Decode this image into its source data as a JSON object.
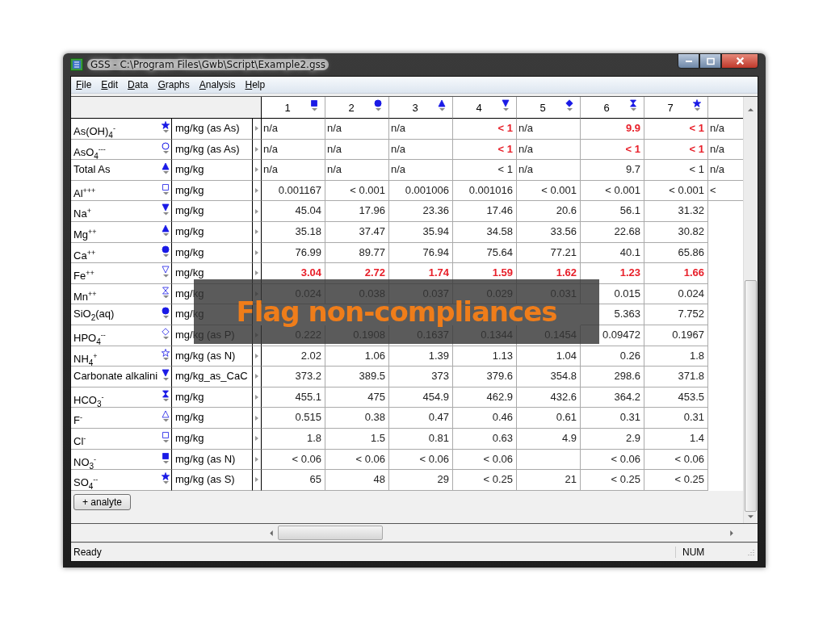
{
  "window": {
    "title": "GSS - C:\\Program Files\\Gwb\\Script\\Example2.gss"
  },
  "menu": [
    "File",
    "Edit",
    "Data",
    "Graphs",
    "Analysis",
    "Help"
  ],
  "columns": [
    {
      "label": "1"
    },
    {
      "label": "2"
    },
    {
      "label": "3"
    },
    {
      "label": "4"
    },
    {
      "label": "5"
    },
    {
      "label": "6"
    },
    {
      "label": "7"
    }
  ],
  "rows": [
    {
      "name": "As(OH)$_{4}$$^{-}$",
      "unit": "mg/kg (as As)",
      "cells": [
        {
          "text": "n/a",
          "kind": "text",
          "flagged": false
        },
        {
          "text": "n/a",
          "kind": "text",
          "flagged": false
        },
        {
          "text": "n/a",
          "kind": "text",
          "flagged": false
        },
        {
          "text": "< 1",
          "kind": "number",
          "flagged": true
        },
        {
          "text": "n/a",
          "kind": "text",
          "flagged": false
        },
        {
          "text": "9.9",
          "kind": "number",
          "flagged": true
        },
        {
          "text": "< 1",
          "kind": "number",
          "flagged": true
        },
        {
          "text": "n/a",
          "kind": "text",
          "flagged": false
        }
      ]
    },
    {
      "name": "AsO$_{4}$$^{---}$",
      "unit": "mg/kg (as As)",
      "cells": [
        {
          "text": "n/a",
          "kind": "text",
          "flagged": false
        },
        {
          "text": "n/a",
          "kind": "text",
          "flagged": false
        },
        {
          "text": "n/a",
          "kind": "text",
          "flagged": false
        },
        {
          "text": "< 1",
          "kind": "number",
          "flagged": true
        },
        {
          "text": "n/a",
          "kind": "text",
          "flagged": false
        },
        {
          "text": "< 1",
          "kind": "number",
          "flagged": true
        },
        {
          "text": "< 1",
          "kind": "number",
          "flagged": true
        },
        {
          "text": "n/a",
          "kind": "text",
          "flagged": false
        }
      ]
    },
    {
      "name": "Total As",
      "unit": "mg/kg",
      "cells": [
        {
          "text": "n/a",
          "kind": "text",
          "flagged": false
        },
        {
          "text": "n/a",
          "kind": "text",
          "flagged": false
        },
        {
          "text": "n/a",
          "kind": "text",
          "flagged": false
        },
        {
          "text": "< 1",
          "kind": "number",
          "flagged": false
        },
        {
          "text": "n/a",
          "kind": "text",
          "flagged": false
        },
        {
          "text": "9.7",
          "kind": "number",
          "flagged": false
        },
        {
          "text": "< 1",
          "kind": "number",
          "flagged": false
        },
        {
          "text": "n/a",
          "kind": "text",
          "flagged": false
        }
      ]
    },
    {
      "name": "Al$^{+++}$",
      "unit": "mg/kg",
      "cells": [
        {
          "text": "0.001167",
          "kind": "number",
          "flagged": false
        },
        {
          "text": "< 0.001",
          "kind": "number",
          "flagged": false
        },
        {
          "text": "0.001006",
          "kind": "number",
          "flagged": false
        },
        {
          "text": "0.001016",
          "kind": "number",
          "flagged": false
        },
        {
          "text": "< 0.001",
          "kind": "number",
          "flagged": false
        },
        {
          "text": "< 0.001",
          "kind": "number",
          "flagged": false
        },
        {
          "text": "< 0.001",
          "kind": "number",
          "flagged": false
        },
        {
          "text": "<",
          "kind": "text",
          "flagged": false
        }
      ]
    },
    {
      "name": "Na$^{+}$",
      "unit": "mg/kg",
      "cells": [
        {
          "text": "45.04",
          "kind": "number",
          "flagged": false
        },
        {
          "text": "17.96",
          "kind": "number",
          "flagged": false
        },
        {
          "text": "23.36",
          "kind": "number",
          "flagged": false
        },
        {
          "text": "17.46",
          "kind": "number",
          "flagged": false
        },
        {
          "text": "20.6",
          "kind": "number",
          "flagged": false
        },
        {
          "text": "56.1",
          "kind": "number",
          "flagged": false
        },
        {
          "text": "31.32",
          "kind": "number",
          "flagged": false
        }
      ]
    },
    {
      "name": "Mg$^{++}$",
      "unit": "mg/kg",
      "cells": [
        {
          "text": "35.18",
          "kind": "number",
          "flagged": false
        },
        {
          "text": "37.47",
          "kind": "number",
          "flagged": false
        },
        {
          "text": "35.94",
          "kind": "number",
          "flagged": false
        },
        {
          "text": "34.58",
          "kind": "number",
          "flagged": false
        },
        {
          "text": "33.56",
          "kind": "number",
          "flagged": false
        },
        {
          "text": "22.68",
          "kind": "number",
          "flagged": false
        },
        {
          "text": "30.82",
          "kind": "number",
          "flagged": false
        }
      ]
    },
    {
      "name": "Ca$^{++}$",
      "unit": "mg/kg",
      "cells": [
        {
          "text": "76.99",
          "kind": "number",
          "flagged": false
        },
        {
          "text": "89.77",
          "kind": "number",
          "flagged": false
        },
        {
          "text": "76.94",
          "kind": "number",
          "flagged": false
        },
        {
          "text": "75.64",
          "kind": "number",
          "flagged": false
        },
        {
          "text": "77.21",
          "kind": "number",
          "flagged": false
        },
        {
          "text": "40.1",
          "kind": "number",
          "flagged": false
        },
        {
          "text": "65.86",
          "kind": "number",
          "flagged": false
        }
      ]
    },
    {
      "name": "Fe$^{++}$",
      "unit": "mg/kg",
      "cells": [
        {
          "text": "3.04",
          "kind": "number",
          "flagged": true
        },
        {
          "text": "2.72",
          "kind": "number",
          "flagged": true
        },
        {
          "text": "1.74",
          "kind": "number",
          "flagged": true
        },
        {
          "text": "1.59",
          "kind": "number",
          "flagged": true
        },
        {
          "text": "1.62",
          "kind": "number",
          "flagged": true
        },
        {
          "text": "1.23",
          "kind": "number",
          "flagged": true
        },
        {
          "text": "1.66",
          "kind": "number",
          "flagged": true
        }
      ]
    },
    {
      "name": "Mn$^{++}$",
      "unit": "mg/kg",
      "cells": [
        {
          "text": "0.024",
          "kind": "number",
          "flagged": false
        },
        {
          "text": "0.038",
          "kind": "number",
          "flagged": false
        },
        {
          "text": "0.037",
          "kind": "number",
          "flagged": false
        },
        {
          "text": "0.029",
          "kind": "number",
          "flagged": false
        },
        {
          "text": "0.031",
          "kind": "number",
          "flagged": false
        },
        {
          "text": "0.015",
          "kind": "number",
          "flagged": false
        },
        {
          "text": "0.024",
          "kind": "number",
          "flagged": false
        }
      ]
    },
    {
      "name": "SiO$_{2}$(aq)",
      "unit": "mg/kg",
      "cells": [
        null,
        null,
        null,
        null,
        null,
        {
          "text": "5.363",
          "kind": "number",
          "flagged": false
        },
        {
          "text": "7.752",
          "kind": "number",
          "flagged": false
        }
      ]
    },
    {
      "name": "HPO$_{4}$$^{--}$",
      "unit": "mg/kg (as P)",
      "cells": [
        {
          "text": "0.222",
          "kind": "number",
          "flagged": false
        },
        {
          "text": "0.1908",
          "kind": "number",
          "flagged": false
        },
        {
          "text": "0.1637",
          "kind": "number",
          "flagged": false
        },
        {
          "text": "0.1344",
          "kind": "number",
          "flagged": false
        },
        {
          "text": "0.1454",
          "kind": "number",
          "flagged": false
        },
        {
          "text": "0.09472",
          "kind": "number",
          "flagged": false
        },
        {
          "text": "0.1967",
          "kind": "number",
          "flagged": false
        }
      ]
    },
    {
      "name": "NH$_{4}$$^{+}$",
      "unit": "mg/kg (as N)",
      "cells": [
        {
          "text": "2.02",
          "kind": "number",
          "flagged": false
        },
        {
          "text": "1.06",
          "kind": "number",
          "flagged": false
        },
        {
          "text": "1.39",
          "kind": "number",
          "flagged": false
        },
        {
          "text": "1.13",
          "kind": "number",
          "flagged": false
        },
        {
          "text": "1.04",
          "kind": "number",
          "flagged": false
        },
        {
          "text": "0.26",
          "kind": "number",
          "flagged": false
        },
        {
          "text": "1.8",
          "kind": "number",
          "flagged": false
        }
      ]
    },
    {
      "name": "Carbonate alkalini",
      "unit": "mg/kg_as_CaC",
      "cells": [
        {
          "text": "373.2",
          "kind": "number",
          "flagged": false
        },
        {
          "text": "389.5",
          "kind": "number",
          "flagged": false
        },
        {
          "text": "373",
          "kind": "number",
          "flagged": false
        },
        {
          "text": "379.6",
          "kind": "number",
          "flagged": false
        },
        {
          "text": "354.8",
          "kind": "number",
          "flagged": false
        },
        {
          "text": "298.6",
          "kind": "number",
          "flagged": false
        },
        {
          "text": "371.8",
          "kind": "number",
          "flagged": false
        }
      ]
    },
    {
      "name": "HCO$_{3}$$^{-}$",
      "unit": "mg/kg",
      "cells": [
        {
          "text": "455.1",
          "kind": "number",
          "flagged": false
        },
        {
          "text": "475",
          "kind": "number",
          "flagged": false
        },
        {
          "text": "454.9",
          "kind": "number",
          "flagged": false
        },
        {
          "text": "462.9",
          "kind": "number",
          "flagged": false
        },
        {
          "text": "432.6",
          "kind": "number",
          "flagged": false
        },
        {
          "text": "364.2",
          "kind": "number",
          "flagged": false
        },
        {
          "text": "453.5",
          "kind": "number",
          "flagged": false
        }
      ]
    },
    {
      "name": "F$^{-}$",
      "unit": "mg/kg",
      "cells": [
        {
          "text": "0.515",
          "kind": "number",
          "flagged": false
        },
        {
          "text": "0.38",
          "kind": "number",
          "flagged": false
        },
        {
          "text": "0.47",
          "kind": "number",
          "flagged": false
        },
        {
          "text": "0.46",
          "kind": "number",
          "flagged": false
        },
        {
          "text": "0.61",
          "kind": "number",
          "flagged": false
        },
        {
          "text": "0.31",
          "kind": "number",
          "flagged": false
        },
        {
          "text": "0.31",
          "kind": "number",
          "flagged": false
        }
      ]
    },
    {
      "name": "Cl$^{-}$",
      "unit": "mg/kg",
      "cells": [
        {
          "text": "1.8",
          "kind": "number",
          "flagged": false
        },
        {
          "text": "1.5",
          "kind": "number",
          "flagged": false
        },
        {
          "text": "0.81",
          "kind": "number",
          "flagged": false
        },
        {
          "text": "0.63",
          "kind": "number",
          "flagged": false
        },
        {
          "text": "4.9",
          "kind": "number",
          "flagged": false
        },
        {
          "text": "2.9",
          "kind": "number",
          "flagged": false
        },
        {
          "text": "1.4",
          "kind": "number",
          "flagged": false
        }
      ]
    },
    {
      "name": "NO$_{3}$$^{-}$",
      "unit": "mg/kg (as N)",
      "cells": [
        {
          "text": "< 0.06",
          "kind": "number",
          "flagged": false
        },
        {
          "text": "< 0.06",
          "kind": "number",
          "flagged": false
        },
        {
          "text": "< 0.06",
          "kind": "number",
          "flagged": false
        },
        {
          "text": "< 0.06",
          "kind": "number",
          "flagged": false
        },
        null,
        {
          "text": "< 0.06",
          "kind": "number",
          "flagged": false
        },
        {
          "text": "< 0.06",
          "kind": "number",
          "flagged": false
        }
      ]
    },
    {
      "name": "SO$_{4}$$^{--}$",
      "unit": "mg/kg (as S)",
      "cells": [
        {
          "text": "65",
          "kind": "number",
          "flagged": false
        },
        {
          "text": "48",
          "kind": "number",
          "flagged": false
        },
        {
          "text": "29",
          "kind": "number",
          "flagged": false
        },
        {
          "text": "< 0.25",
          "kind": "number",
          "flagged": false
        },
        {
          "text": "21",
          "kind": "number",
          "flagged": false
        },
        {
          "text": "< 0.25",
          "kind": "number",
          "flagged": false
        },
        {
          "text": "< 0.25",
          "kind": "number",
          "flagged": false
        }
      ]
    }
  ],
  "add_button": "+ analyte",
  "caption": "Flag non-compliances",
  "status_bar": {
    "message": "Ready",
    "indicator": "NUM"
  }
}
